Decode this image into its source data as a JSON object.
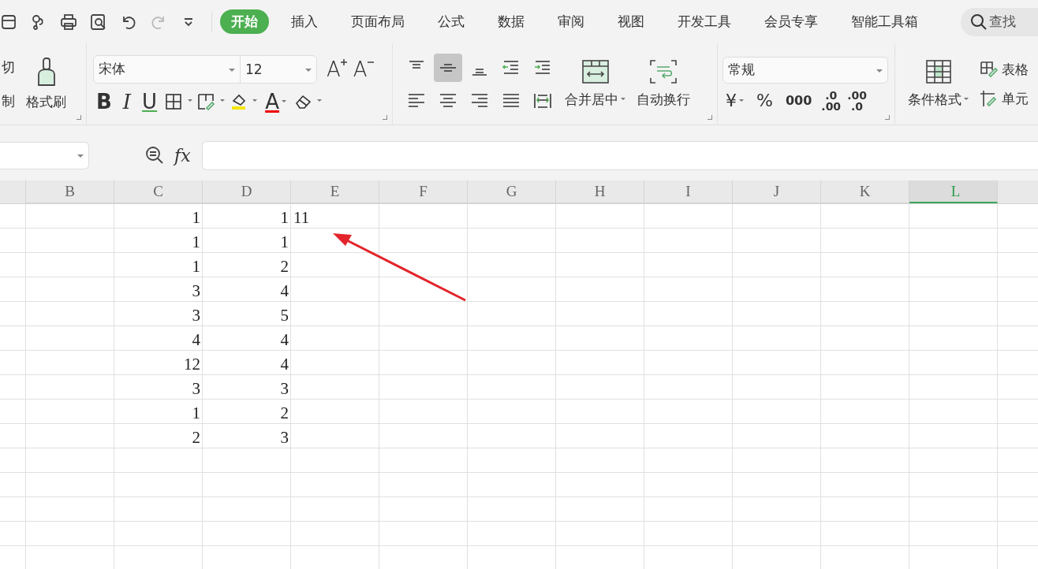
{
  "quick_access": [
    {
      "kind": "save",
      "disabled": false
    },
    {
      "kind": "format",
      "disabled": false
    },
    {
      "kind": "print",
      "disabled": false
    },
    {
      "kind": "preview",
      "disabled": false
    },
    {
      "kind": "undo",
      "disabled": false
    },
    {
      "kind": "redo",
      "disabled": true
    },
    {
      "kind": "more",
      "disabled": false
    }
  ],
  "tabs": [
    {
      "label": "开始",
      "selected": true
    },
    {
      "label": "插入",
      "selected": false
    },
    {
      "label": "页面布局",
      "selected": false
    },
    {
      "label": "公式",
      "selected": false
    },
    {
      "label": "数据",
      "selected": false
    },
    {
      "label": "审阅",
      "selected": false
    },
    {
      "label": "视图",
      "selected": false
    },
    {
      "label": "开发工具",
      "selected": false
    },
    {
      "label": "会员专享",
      "selected": false
    },
    {
      "label": "智能工具箱",
      "selected": false
    }
  ],
  "search": {
    "placeholder": "查找"
  },
  "clipboard": {
    "cut": "切",
    "copy": "制",
    "painter": "格式刷"
  },
  "font": {
    "family": "宋体",
    "size": "12"
  },
  "font_size_buttons": [
    {
      "kind": "grow",
      "glyph": "A"
    },
    {
      "kind": "shrink",
      "glyph": "A"
    }
  ],
  "font_buttons": [
    {
      "kind": "bold",
      "glyph": "B"
    },
    {
      "kind": "italic",
      "glyph": "I"
    },
    {
      "kind": "underline",
      "glyph": "U"
    },
    {
      "kind": "border"
    },
    {
      "kind": "cell-style"
    },
    {
      "kind": "fill"
    },
    {
      "kind": "font-color",
      "glyph": "A"
    },
    {
      "kind": "clear"
    }
  ],
  "align_buttons": [
    {
      "kind": "top",
      "selected": false
    },
    {
      "kind": "middle",
      "selected": true
    },
    {
      "kind": "bottom",
      "selected": false
    },
    {
      "kind": "outdent",
      "selected": false
    },
    {
      "kind": "indent",
      "selected": false
    },
    {
      "kind": "left",
      "selected": false
    },
    {
      "kind": "center",
      "selected": false
    },
    {
      "kind": "right",
      "selected": false
    },
    {
      "kind": "justify",
      "selected": false
    },
    {
      "kind": "distribute",
      "selected": false
    }
  ],
  "merge": {
    "label": "合并居中"
  },
  "wrap": {
    "label": "自动换行"
  },
  "number": {
    "format": "常规",
    "currency": "¥",
    "percent": "%",
    "thousands": "000",
    "inc_decimal": {
      "top": ".0",
      "bottom": ".00"
    },
    "dec_decimal": {
      "top": ".00",
      "bottom": ".0"
    }
  },
  "styles": {
    "conditional": "条件格式",
    "table": "表格",
    "cell": "单元"
  },
  "formula_bar": {
    "fx": "fx"
  },
  "columns": [
    {
      "label": "B",
      "selected": false
    },
    {
      "label": "C",
      "selected": false
    },
    {
      "label": "D",
      "selected": false
    },
    {
      "label": "E",
      "selected": false
    },
    {
      "label": "F",
      "selected": false
    },
    {
      "label": "G",
      "selected": false
    },
    {
      "label": "H",
      "selected": false
    },
    {
      "label": "I",
      "selected": false
    },
    {
      "label": "J",
      "selected": false
    },
    {
      "label": "K",
      "selected": false
    },
    {
      "label": "L",
      "selected": true
    }
  ],
  "rows": [
    [
      "",
      "1",
      "1",
      "11"
    ],
    [
      "",
      "1",
      "1",
      ""
    ],
    [
      "",
      "1",
      "2",
      ""
    ],
    [
      "",
      "3",
      "4",
      ""
    ],
    [
      "",
      "3",
      "5",
      ""
    ],
    [
      "",
      "4",
      "4",
      ""
    ],
    [
      "",
      "12",
      "4",
      ""
    ],
    [
      "",
      "3",
      "3",
      ""
    ],
    [
      "",
      "1",
      "2",
      ""
    ],
    [
      "",
      "2",
      "3",
      ""
    ],
    [
      "",
      "",
      "",
      ""
    ],
    [
      "",
      "",
      "",
      ""
    ],
    [
      "",
      "",
      "",
      ""
    ],
    [
      "",
      "",
      "",
      ""
    ],
    [
      "",
      "",
      "",
      ""
    ]
  ],
  "annotation_arrow": true
}
